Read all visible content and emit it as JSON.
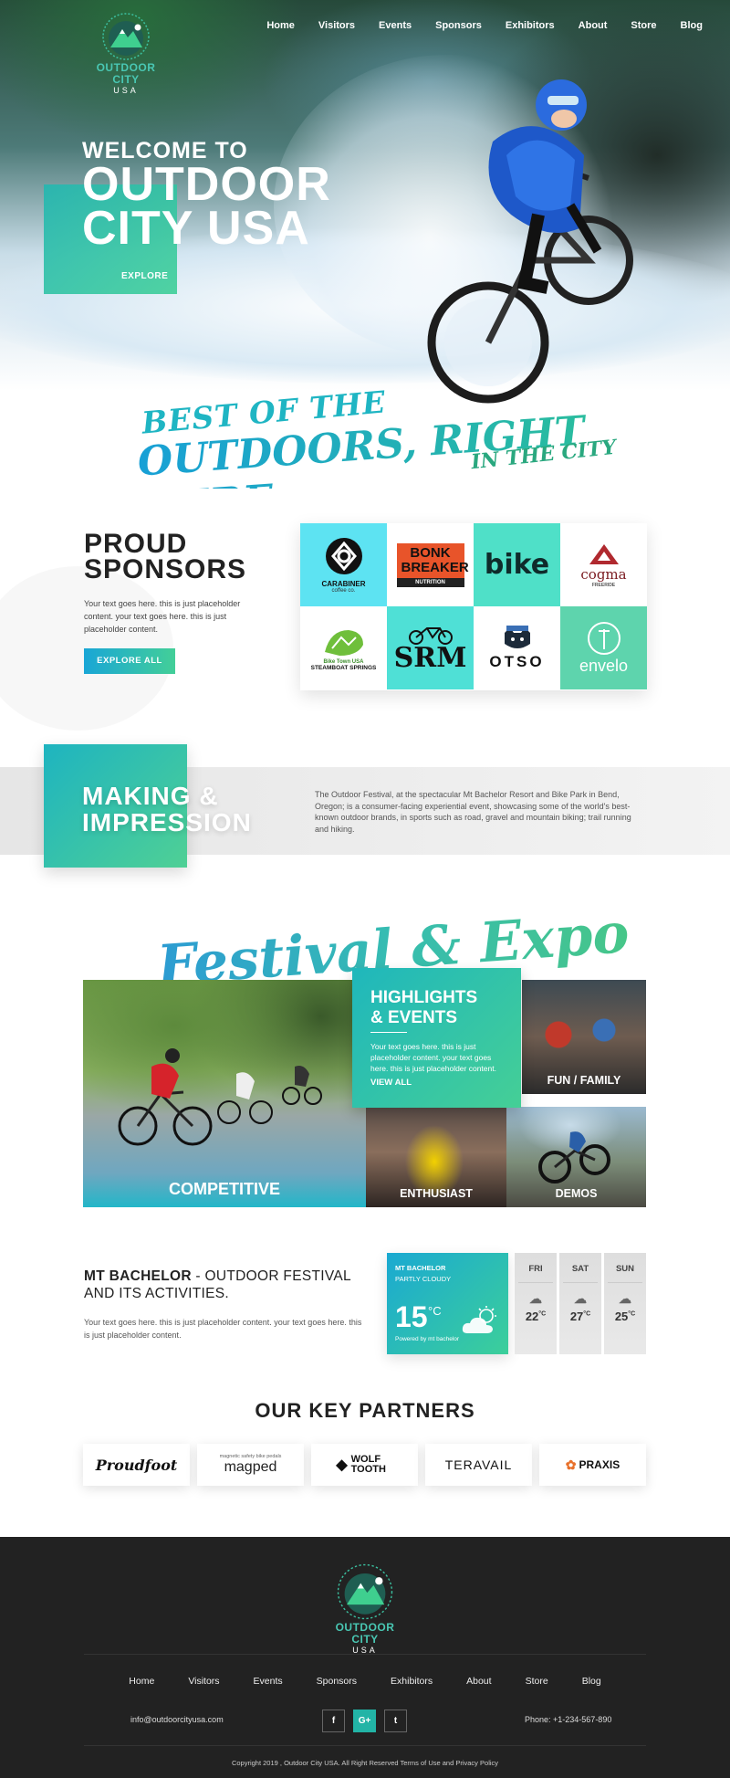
{
  "brand": {
    "name": "OUTDOOR CITY",
    "sub": "USA",
    "ring_text": "BEST OF THE OUTDOORS, RIGHT HERE IN THE CITY"
  },
  "nav": [
    "Home",
    "Visitors",
    "Events",
    "Sponsors",
    "Exhibitors",
    "About",
    "Store",
    "Blog"
  ],
  "hero": {
    "welcome": "WELCOME TO",
    "title_line1": "OUTDOOR",
    "title_line2": "CITY USA",
    "explore": "EXPLORE",
    "script1": "BEST OF THE",
    "script2": "OUTDOORS, RIGHT HERE",
    "script3": "IN THE CITY"
  },
  "sponsors": {
    "title_line1": "PROUD",
    "title_line2": "SPONSORS",
    "text": "Your text goes here. this is just placeholder content. your text goes here. this is just placeholder content.",
    "button": "EXPLORE ALL",
    "logos": [
      {
        "name": "CARABINER",
        "sub": "coffee co."
      },
      {
        "name": "BONK BREAKER",
        "sub": "NUTRITION"
      },
      {
        "name": "bike",
        "sub": ""
      },
      {
        "name": "cogma",
        "sub": "FREERIDE"
      },
      {
        "name": "Bike Town USA",
        "sub": "STEAMBOAT SPRINGS"
      },
      {
        "name": "SRM",
        "sub": ""
      },
      {
        "name": "OTSO",
        "sub": ""
      },
      {
        "name": "envelo",
        "sub": ""
      }
    ]
  },
  "impression": {
    "title_line1": "MAKING &",
    "title_line2": "IMPRESSION",
    "text": "The Outdoor Festival, at the spectacular Mt Bachelor Resort and Bike Park in Bend, Oregon; is a consumer-facing experiential event, showcasing some of the world's best-known outdoor brands, in sports such as road, gravel and mountain biking; trail running and hiking."
  },
  "festival": {
    "script": "Festival & Expo",
    "highlights_title_line1": "HIGHLIGHTS",
    "highlights_title_line2": "& EVENTS",
    "highlights_text": "Your text goes here. this is just placeholder content. your text goes here. this is just placeholder content.",
    "view_all": "VIEW ALL",
    "tiles": {
      "competitive": "COMPETITIVE",
      "fun": "FUN / FAMILY",
      "enthusiast": "ENTHUSIAST",
      "demos": "DEMOS"
    }
  },
  "mt_bachelor": {
    "title_bold": "MT BACHELOR",
    "title_rest": " - OUTDOOR FESTIVAL AND ITS ACTIVITIES.",
    "text": "Your text goes here. this is just placeholder content. your text goes here. this is just placeholder content."
  },
  "weather": {
    "location": "MT BACHELOR",
    "condition": "PARTLY CLOUDY",
    "temp": "15",
    "unit": "°C",
    "powered": "Powered by mt bachelor",
    "days": [
      {
        "day": "FRI",
        "temp": "22",
        "unit": "°C"
      },
      {
        "day": "SAT",
        "temp": "27",
        "unit": "°C"
      },
      {
        "day": "SUN",
        "temp": "25",
        "unit": "°C"
      }
    ]
  },
  "partners": {
    "title": "OUR KEY PARTNERS",
    "logos": [
      "Proudfoot",
      "magped",
      "WOLF TOOTH",
      "TERAVAIL",
      "PRAXIS"
    ],
    "magped_tag": "magnetic safety bike pedals"
  },
  "footer": {
    "nav": [
      "Home",
      "Visitors",
      "Events",
      "Sponsors",
      "Exhibitors",
      "About",
      "Store",
      "Blog"
    ],
    "email": "info@outdoorcityusa.com",
    "phone": "Phone: +1-234-567-890",
    "social": [
      "f",
      "G+",
      "t"
    ],
    "copyright": "Copyright 2019 , Outdoor City USA. All Right Reserved Terms of Use and Privacy Policy"
  },
  "colors": {
    "teal": "#23b7b1",
    "green": "#43cf98",
    "blue": "#19a6d6",
    "dark": "#222222"
  }
}
